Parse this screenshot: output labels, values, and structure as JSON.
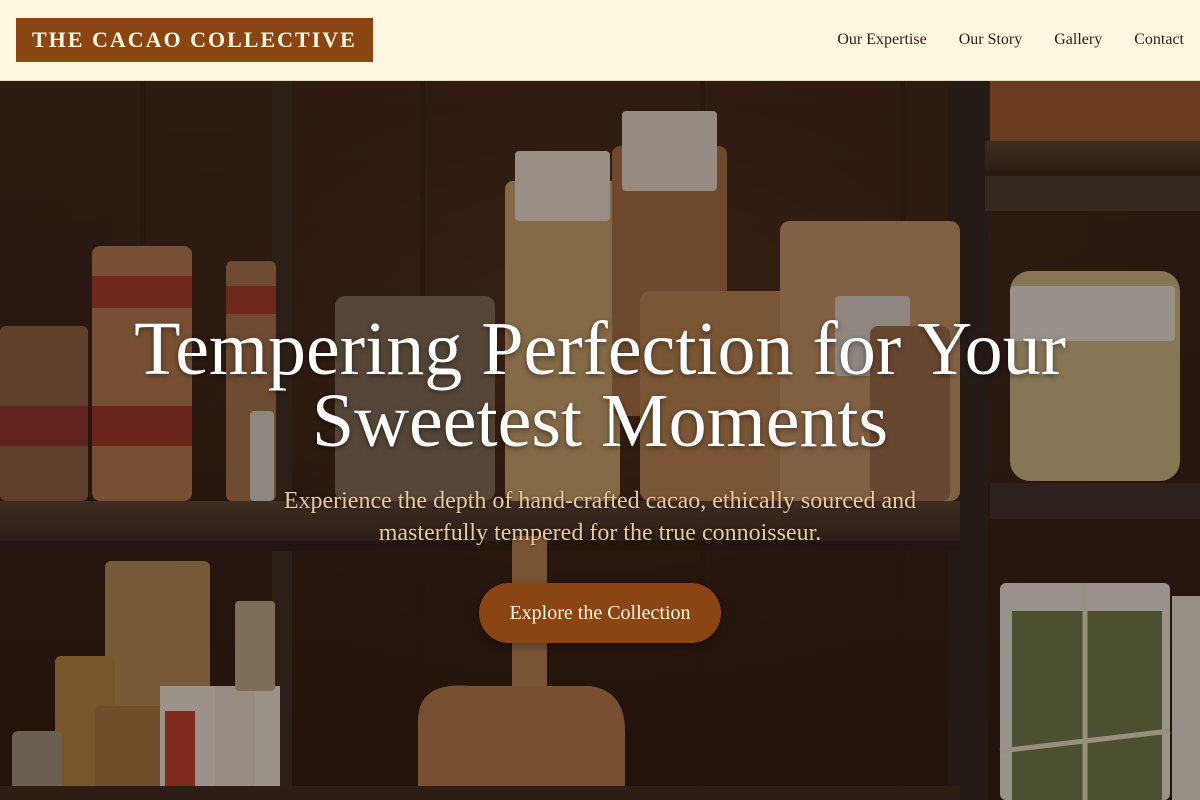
{
  "header": {
    "brand": "THE CACAO COLLECTIVE",
    "nav": [
      {
        "label": "Our Expertise"
      },
      {
        "label": "Our Story"
      },
      {
        "label": "Gallery"
      },
      {
        "label": "Contact"
      }
    ]
  },
  "hero": {
    "title": "Tempering Perfection for Your Sweetest Moments",
    "subtitle": "Experience the depth of hand-crafted cacao, ethically sourced and masterfully tempered for the true connoisseur.",
    "cta_label": "Explore the Collection",
    "background": "pantry shelves with bagged pasta and jars"
  },
  "colors": {
    "header_bg": "#fff8e1",
    "brand_bg": "#8b4513",
    "accent": "#8b4513",
    "subtitle": "#e9c9a0",
    "title": "#ffffff"
  }
}
